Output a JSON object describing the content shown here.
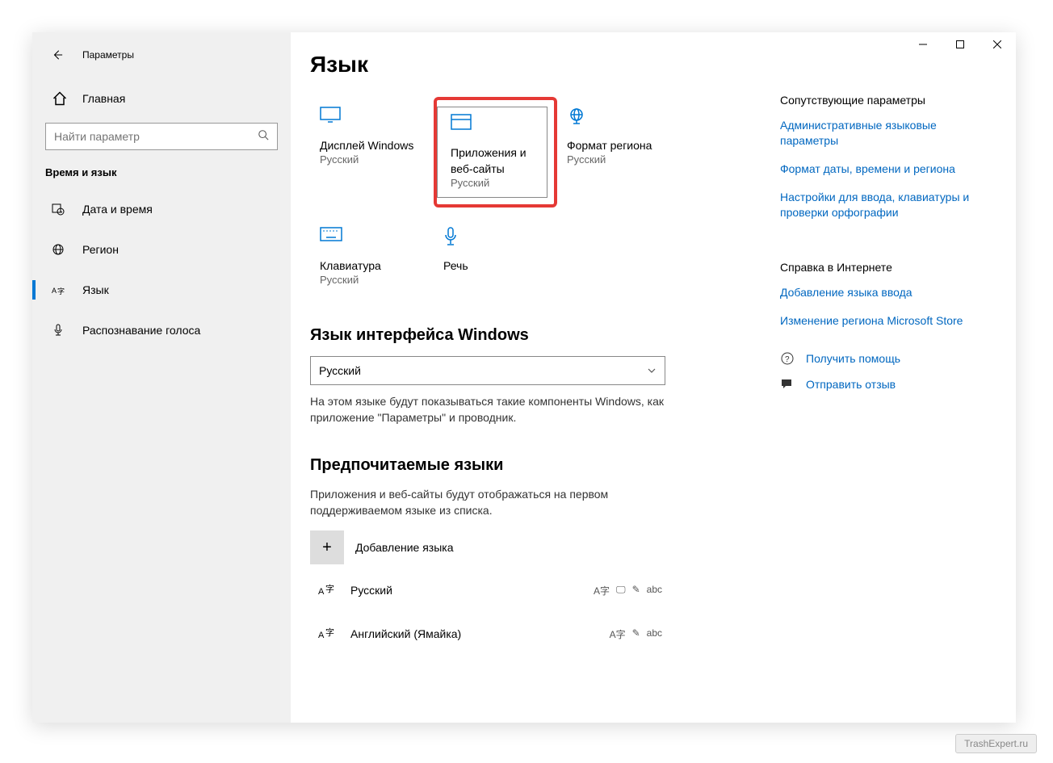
{
  "window": {
    "title": "Параметры"
  },
  "sidebar": {
    "home": "Главная",
    "search_placeholder": "Найти параметр",
    "section": "Время и язык",
    "items": [
      {
        "label": "Дата и время"
      },
      {
        "label": "Регион"
      },
      {
        "label": "Язык"
      },
      {
        "label": "Распознавание голоса"
      }
    ]
  },
  "main": {
    "title": "Язык",
    "tiles": [
      {
        "label": "Дисплей Windows",
        "sub": "Русский"
      },
      {
        "label": "Приложения и веб-сайты",
        "sub": "Русский"
      },
      {
        "label": "Формат региона",
        "sub": "Русский"
      },
      {
        "label": "Клавиатура",
        "sub": "Русский"
      },
      {
        "label": "Речь",
        "sub": ""
      }
    ],
    "section1_title": "Язык интерфейса Windows",
    "combobox_value": "Русский",
    "section1_desc": "На этом языке будут показываться такие компоненты Windows, как приложение \"Параметры\" и проводник.",
    "section2_title": "Предпочитаемые языки",
    "section2_desc": "Приложения и веб-сайты будут отображаться на первом поддерживаемом языке из списка.",
    "add_language": "Добавление языка",
    "languages": [
      {
        "name": "Русский"
      },
      {
        "name": "Английский (Ямайка)"
      }
    ]
  },
  "rail": {
    "related_title": "Сопутствующие параметры",
    "links": [
      "Административные языковые параметры",
      "Формат даты, времени и региона",
      "Настройки для ввода, клавиатуры и проверки орфографии"
    ],
    "help_title": "Справка в Интернете",
    "help_links": [
      "Добавление языка ввода",
      "Изменение региона Microsoft Store"
    ],
    "get_help": "Получить помощь",
    "feedback": "Отправить отзыв"
  },
  "watermark": "TrashExpert.ru"
}
